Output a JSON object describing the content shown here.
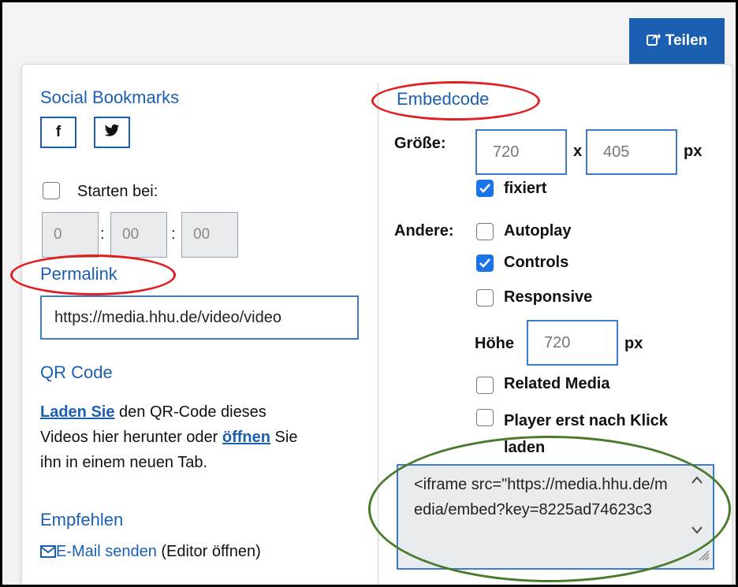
{
  "share": {
    "label": "Teilen",
    "icon": "share-icon"
  },
  "social": {
    "title": "Social Bookmarks",
    "facebook_label": "f"
  },
  "start": {
    "label": "Starten bei:",
    "hours": "0",
    "minutes": "00",
    "seconds": "00"
  },
  "permalink": {
    "title": "Permalink",
    "value": "https://media.hhu.de/video/video"
  },
  "qr": {
    "title": "QR Code",
    "link1": "Laden Sie",
    "text1": " den QR-Code dieses",
    "text2": "Videos hier herunter oder ",
    "link2": "öffnen",
    "text3": " Sie",
    "text4": "ihn in einem neuen Tab."
  },
  "recommend": {
    "title": "Empfehlen",
    "email_link": "E-Mail senden",
    "email_note": " (Editor öffnen)"
  },
  "embed": {
    "title": "Embedcode",
    "size_label": "Größe:",
    "width": "720",
    "times": "x",
    "height": "405",
    "unit": "px",
    "fixed_label": "fixiert",
    "other_label": "Andere:",
    "autoplay_label": "Autoplay",
    "controls_label": "Controls",
    "responsive_label": "Responsive",
    "hoehe_label": "Höhe",
    "hoehe_value": "720",
    "hoehe_unit": "px",
    "related_label": "Related Media",
    "player_label_1": "Player erst nach Klick",
    "player_label_2": "laden",
    "code": "<iframe src=\"https://media.hhu.de/media/embed?key=8225ad74623c3"
  },
  "colors": {
    "accent": "#1b5fb3",
    "annotation_red": "#e02020",
    "annotation_green": "#4a7a2c"
  }
}
